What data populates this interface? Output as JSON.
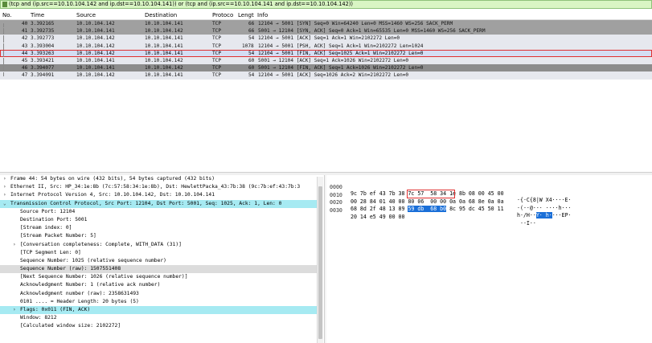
{
  "filter": {
    "value": "(tcp and (ip.src==10.10.104.142 and ip.dst==10.10.104.141)) or (tcp and (ip.src==10.10.104.141 and ip.dst==10.10.104.142))"
  },
  "packet_list": {
    "columns": [
      "No.",
      "Time",
      "Source",
      "Destination",
      "Protoco",
      "Lengt",
      "Info"
    ],
    "rows": [
      {
        "no": "40",
        "time": "3.392165",
        "src": "10.10.104.142",
        "dst": "10.10.104.141",
        "proto": "TCP",
        "len": "66",
        "info": "12104 → 5001 [SYN] Seq=0 Win=64240 Len=0 MSS=1460 WS=256 SACK_PERM"
      },
      {
        "no": "41",
        "time": "3.392735",
        "src": "10.10.104.141",
        "dst": "10.10.104.142",
        "proto": "TCP",
        "len": "66",
        "info": "5001 → 12104 [SYN, ACK] Seq=0 Ack=1 Win=65535 Len=0 MSS=1460 WS=256 SACK_PERM"
      },
      {
        "no": "42",
        "time": "3.392773",
        "src": "10.10.104.142",
        "dst": "10.10.104.141",
        "proto": "TCP",
        "len": "54",
        "info": "12104 → 5001 [ACK] Seq=1 Ack=1 Win=2102272 Len=0"
      },
      {
        "no": "43",
        "time": "3.393004",
        "src": "10.10.104.142",
        "dst": "10.10.104.141",
        "proto": "TCP",
        "len": "1078",
        "info": "12104 → 5001 [PSH, ACK] Seq=1 Ack=1 Win=2102272 Len=1024"
      },
      {
        "no": "44",
        "time": "3.393263",
        "src": "10.10.104.142",
        "dst": "10.10.104.141",
        "proto": "TCP",
        "len": "54",
        "info": "12104 → 5001 [FIN, ACK] Seq=1025 Ack=1 Win=2102272 Len=0"
      },
      {
        "no": "45",
        "time": "3.393421",
        "src": "10.10.104.141",
        "dst": "10.10.104.142",
        "proto": "TCP",
        "len": "60",
        "info": "5001 → 12104 [ACK] Seq=1 Ack=1026 Win=2102272 Len=0"
      },
      {
        "no": "46",
        "time": "3.394077",
        "src": "10.10.104.141",
        "dst": "10.10.104.142",
        "proto": "TCP",
        "len": "60",
        "info": "5001 → 12104 [FIN, ACK] Seq=1 Ack=1026 Win=2102272 Len=0"
      },
      {
        "no": "47",
        "time": "3.394091",
        "src": "10.10.104.142",
        "dst": "10.10.104.141",
        "proto": "TCP",
        "len": "54",
        "info": "12104 → 5001 [ACK] Seq=1026 Ack=2 Win=2102272 Len=0"
      }
    ]
  },
  "details": {
    "lines": [
      {
        "arrow": "›",
        "text": "Frame 44: 54 bytes on wire (432 bits), 54 bytes captured (432 bits)"
      },
      {
        "arrow": "›",
        "text": "Ethernet II, Src: HP_34:1e:8b (7c:57:58:34:1e:8b), Dst: HewlettPacka_43:7b:38 (9c:7b:ef:43:7b:3"
      },
      {
        "arrow": "›",
        "text": "Internet Protocol Version 4, Src: 10.10.104.142, Dst: 10.10.104.141"
      },
      {
        "arrow": "⌄",
        "text": "Transmission Control Protocol, Src Port: 12104, Dst Port: 5001, Seq: 1025, Ack: 1, Len: 0"
      },
      {
        "arrow": "",
        "text": "Source Port: 12104"
      },
      {
        "arrow": "",
        "text": "Destination Port: 5001"
      },
      {
        "arrow": "",
        "text": "[Stream index: 0]"
      },
      {
        "arrow": "",
        "text": "[Stream Packet Number: 5]"
      },
      {
        "arrow": "›",
        "text": "[Conversation completeness: Complete, WITH_DATA (31)]"
      },
      {
        "arrow": "",
        "text": "[TCP Segment Len: 0]"
      },
      {
        "arrow": "",
        "text": "Sequence Number: 1025    (relative sequence number)"
      },
      {
        "arrow": "",
        "text": "Sequence Number (raw): 1507551408"
      },
      {
        "arrow": "",
        "text": "[Next Sequence Number: 1026    (relative sequence number)]"
      },
      {
        "arrow": "",
        "text": "Acknowledgment Number: 1    (relative ack number)"
      },
      {
        "arrow": "",
        "text": "Acknowledgment number (raw): 2358631493"
      },
      {
        "arrow": "",
        "text": "0101 .... = Header Length: 20 bytes (5)"
      },
      {
        "arrow": "›",
        "text": "Flags: 0x011 (FIN, ACK)"
      },
      {
        "arrow": "",
        "text": "Window: 8212"
      },
      {
        "arrow": "",
        "text": "[Calculated window size: 2102272]"
      }
    ]
  },
  "bytes": {
    "rows": [
      {
        "offset": "0000",
        "hex_a": "9c 7b ef 43 7b 38 7c 57  58 34 1e 8b 08 00 45 00",
        "hex_b": "",
        "hex_hl": "",
        "ascii": "·{·C{8|W X4····E·",
        "ascii_hl": "",
        "ascii_post": ""
      },
      {
        "offset": "0010",
        "hex_a": "00 28 84 01 40 00 80 06  00 00 0a 0a 68 8e 0a 0a",
        "hex_b": "",
        "hex_hl": "",
        "ascii": "·(··@··· ····h···",
        "ascii_hl": "",
        "ascii_post": ""
      },
      {
        "offset": "0020",
        "hex_a": "68 8d 2f 48 13 89 ",
        "hex_hl": "59 db  68 b0",
        "hex_b": " 8c 95 dc 45 50 11",
        "ascii": "h·/H··",
        "ascii_hl": "Y· h·",
        "ascii_post": "···EP·"
      },
      {
        "offset": "0030",
        "hex_a": "20 14 e5 49 00 00",
        "hex_b": "",
        "hex_hl": "",
        "ascii": " ··I··",
        "ascii_hl": "",
        "ascii_post": ""
      }
    ]
  }
}
